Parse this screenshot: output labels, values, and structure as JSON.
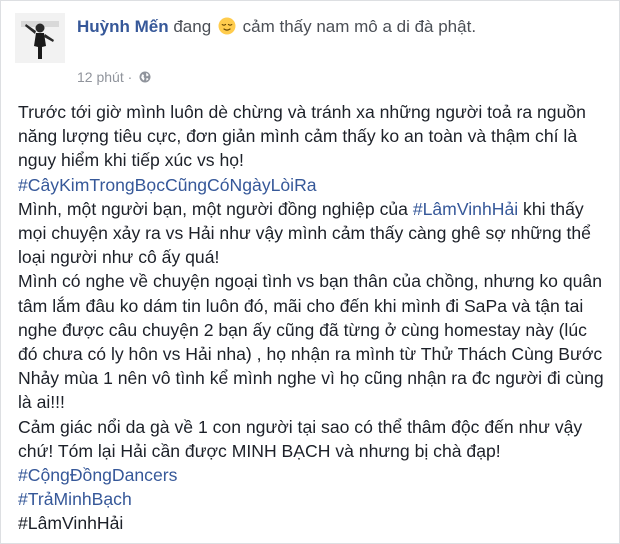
{
  "post": {
    "author": "Huỳnh Mến",
    "status_prefix": "đang",
    "status_feeling": "cảm thấy nam mô a di đà phật.",
    "timestamp": "12 phút",
    "emoji_icon": "relieved-face-icon",
    "privacy_icon": "globe-icon",
    "link_color": "#365899",
    "paragraphs": [
      {
        "type": "text",
        "text": "Trước tới giờ mình luôn dè chừng và tránh xa những người toả ra nguồn năng lượng tiêu cực, đơn giản mình cảm thấy ko an toàn và thậm chí là nguy hiểm khi tiếp xúc vs họ!"
      },
      {
        "type": "hashtag",
        "text": "#CâyKimTrongBọcCũngCóNgàyLòiRa"
      },
      {
        "type": "mixed",
        "before": "Mình, một người bạn, một người đồng nghiệp của ",
        "tag": "#LâmVinhHải",
        "after": " khi thấy mọi chuyện xảy ra vs Hải như vậy mình cảm thấy càng ghê sợ những thể loại người như cô ấy quá!"
      },
      {
        "type": "text",
        "text": "Mình có nghe về chuyện ngoại tình vs bạn thân của chồng, nhưng ko quân tâm lắm đâu ko dám tin luôn đó, mãi cho đến khi mình đi SaPa và tận tai nghe được câu chuyện 2 bạn ấy cũng đã từng ở cùng homestay này (lúc đó chưa có ly hôn vs Hải nha) , họ nhận ra mình từ Thử Thách Cùng Bước Nhảy mùa 1 nên vô tình kể mình nghe vì họ cũng nhận ra đc người đi cùng là ai!!!"
      },
      {
        "type": "text",
        "text": "Cảm giác nổi da gà về 1 con người tại sao có thể thâm độc đến như vậy chứ! Tóm lại Hải cần được MINH BẠCH và nhưng bị chà đạp!"
      },
      {
        "type": "hashtag",
        "text": "#CộngĐồngDancers"
      },
      {
        "type": "hashtag",
        "text": "#TrảMinhBạch"
      },
      {
        "type": "text",
        "text": "#LâmVinhHải"
      }
    ]
  }
}
